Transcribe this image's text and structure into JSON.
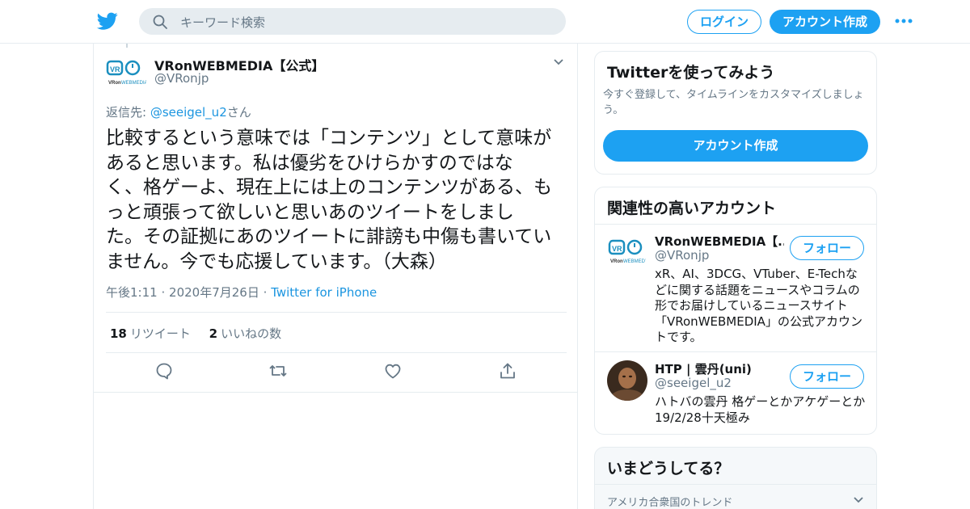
{
  "header": {
    "search_placeholder": "キーワード検索",
    "login_label": "ログイン",
    "signup_label": "アカウント作成",
    "brand_color": "#1da1f2"
  },
  "tweet": {
    "author_name": "VRonWEBMEDIA【公式】",
    "author_handle": "@VRonjp",
    "reply_prefix": "返信先: ",
    "reply_mention": "@seeigel_u2",
    "reply_suffix": "さん",
    "text_lines": [
      "比較するという意味では「コンテンツ」として意味が",
      "あると思います。私は優劣をひけらかすのではな",
      "く、格ゲーよ、現在上には上のコンテンツがある、も",
      "っと頑張って欲しいと思いあのツイートをしまし",
      "た。その証拠にあのツイートに誹謗も中傷も書いてい",
      "ません。今でも応援しています。（大森）"
    ],
    "time": "午後1:11",
    "date": "2020年7月26日",
    "source": "Twitter for iPhone",
    "retweet_count": "18",
    "retweet_label": "リツイート",
    "like_count": "2",
    "like_label": "いいねの数",
    "actions": [
      "reply-icon",
      "retweet-icon",
      "like-icon",
      "share-icon"
    ]
  },
  "sidebar": {
    "signup_card": {
      "title": "Twitterを使ってみよう",
      "description": "今すぐ登録して、タイムラインをカスタマイズしましょう。",
      "button_label": "アカウント作成"
    },
    "related_card": {
      "title": "関連性の高いアカウント",
      "accounts": [
        {
          "name": "VRonWEBMEDIA【...",
          "handle": "@VRonjp",
          "bio": "xR、AI、3DCG、VTuber、E-Techなどに関する話題をニュースやコラムの形でお届けしているニュースサイト「VRonWEBMEDIA」の公式アカウントです。",
          "follow_label": "フォロー"
        },
        {
          "name": "HTP | 雲丹(uni)",
          "handle": "@seeigel_u2",
          "bio": "ハトバの雲丹 格ゲーとかアケゲーとか19/2/28十天極み",
          "follow_label": "フォロー"
        }
      ]
    },
    "trends_card": {
      "title": "いまどうしてる？",
      "location": "アメリカ合衆国のトレンド"
    }
  }
}
